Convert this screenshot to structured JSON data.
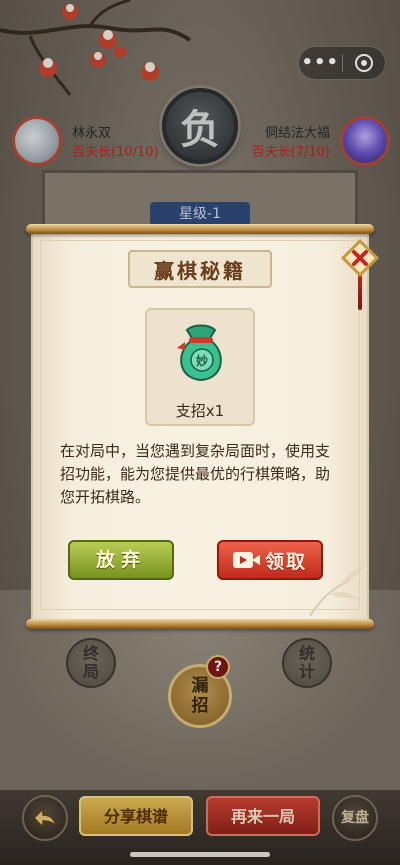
{
  "capsule": {
    "more_label": "•••",
    "more_icon": "more-dots-icon",
    "close_icon": "target-circle-icon"
  },
  "result": {
    "badge": "负"
  },
  "players": [
    {
      "name": "林永双",
      "rank": "百夫长(10/10)"
    },
    {
      "name": "侗结法大福",
      "rank": "百夫长(7/10)"
    }
  ],
  "level_tag": "星级-1",
  "board_actions": {
    "end_game": [
      "终",
      "局"
    ],
    "stats": [
      "统",
      "计"
    ],
    "leak_moves": [
      "漏",
      "招"
    ],
    "help_badge": "?"
  },
  "bottom_bar": {
    "back_icon": "back-arrow-icon",
    "share_label": "分享棋谱",
    "again_label": "再来一局",
    "replay_label": "复盘"
  },
  "modal": {
    "title": "赢棋秘籍",
    "item_seal": "妙",
    "item_label": "支招x1",
    "description": "在对局中，当您遇到复杂局面时，使用支招功能，能为您提供最优的行棋策略，助您开拓棋路。",
    "giveup_label": "放弃",
    "claim_label": "领取",
    "claim_icon": "video-camera-icon",
    "close_icon": "close-x-icon"
  },
  "colors": {
    "rank_red": "#c1251c",
    "giveup_green": "#8ea72f",
    "claim_red": "#d8412f",
    "title_brown": "#6a3d1b"
  }
}
